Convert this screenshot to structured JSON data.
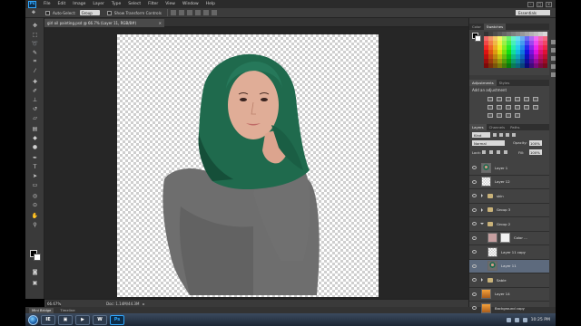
{
  "app": {
    "logo": "Ps",
    "menu": [
      "File",
      "Edit",
      "Image",
      "Layer",
      "Type",
      "Select",
      "Filter",
      "View",
      "Window",
      "Help"
    ],
    "window_controls": [
      "–",
      "□",
      "✕"
    ]
  },
  "options_bar": {
    "auto_select_label": "Auto-Select:",
    "auto_select_value": "Group",
    "show_transform_label": "Show Transform Controls",
    "workspace": "Essentials"
  },
  "document": {
    "tab_title": "girl oil painting.psd @ 66.7% (Layer 11, RGB/8#)",
    "zoom": "66.67%",
    "doc_info": "Doc: 1.14M/44.3M"
  },
  "mini_bridge": {
    "tabs": [
      "Mini Bridge",
      "Timeline"
    ]
  },
  "panels": {
    "color_tabs": [
      "Color",
      "Swatches"
    ],
    "adjustment_tabs": [
      "Adjustments",
      "Styles"
    ],
    "adjustment_title": "Add an adjustment",
    "layer_tabs": [
      "Layers",
      "Channels",
      "Paths"
    ],
    "kind": "Kind",
    "blend_mode": "Normal",
    "opacity_label": "Opacity:",
    "opacity_value": "100%",
    "lock_label": "Lock:",
    "fill_label": "Fill:",
    "fill_value": "100%"
  },
  "layers": [
    {
      "name": "Layer 1",
      "kind": "layer",
      "thumb": "person",
      "italic": false
    },
    {
      "name": "Layer 12",
      "kind": "layer",
      "thumb": "checker",
      "italic": false
    },
    {
      "name": "skin",
      "kind": "group",
      "italic": false
    },
    {
      "name": "Group 3",
      "kind": "group",
      "italic": false
    },
    {
      "name": "Group 2",
      "kind": "group-open",
      "italic": false
    },
    {
      "name": "Color ...",
      "kind": "adjust",
      "italic": false
    },
    {
      "name": "Layer 11 copy",
      "kind": "layer",
      "thumb": "checker",
      "italic": false
    },
    {
      "name": "Layer 11",
      "kind": "layer",
      "thumb": "person",
      "italic": false,
      "selected": true
    },
    {
      "name": "Sable",
      "kind": "group",
      "italic": false
    },
    {
      "name": "Layer 14",
      "kind": "layer",
      "thumb": "orange",
      "italic": false
    },
    {
      "name": "Background copy",
      "kind": "layer",
      "thumb": "orange",
      "italic": false
    },
    {
      "name": "Background",
      "kind": "layer",
      "thumb": "person",
      "italic": true
    }
  ],
  "taskbar": {
    "time": "10:25 PM",
    "apps": [
      "IE",
      "▣",
      "▶",
      "W",
      "Ps"
    ]
  },
  "colors": {
    "ps_blue": "#31a8ff",
    "hijab_green": "#1f6a4d",
    "shirt_gray": "#6c6c6c",
    "selection_blue": "#5d6a7d"
  }
}
